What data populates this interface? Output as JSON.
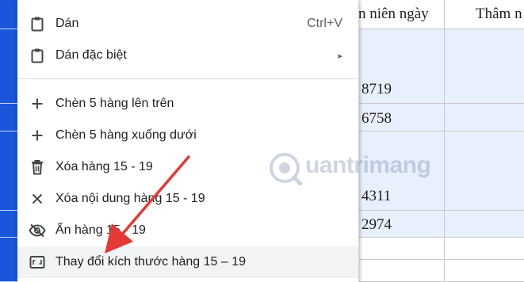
{
  "sheet": {
    "headers": [
      "n niên ngày",
      "Thâm n"
    ],
    "values": [
      "8719",
      "6758",
      "4311",
      "2974"
    ]
  },
  "menu": {
    "items": [
      {
        "label": "Dán",
        "shortcut": "Ctrl+V",
        "icon": "clipboard-icon"
      },
      {
        "label": "Dán đặc biệt",
        "icon": "clipboard-icon",
        "submenu": "▸"
      },
      {
        "label": "Chèn 5 hàng lên trên",
        "icon": "plus-icon"
      },
      {
        "label": "Chèn 5 hàng xuống dưới",
        "icon": "plus-icon"
      },
      {
        "label": "Xóa hàng 15 - 19",
        "icon": "trash-icon"
      },
      {
        "label": "Xóa nội dung hàng 15 - 19",
        "icon": "close-icon"
      },
      {
        "label": "Ẩn hàng 15 - 19",
        "icon": "eye-off-icon"
      },
      {
        "label": "Thay đổi kích thước hàng 15 – 19",
        "icon": "resize-icon"
      }
    ]
  },
  "watermark": {
    "text": "uantrimang"
  },
  "colors": {
    "accent": "#1a56db",
    "selection": "#e8f0fe",
    "arrow": "#e53935",
    "menu_highlight": "#f1f3f4"
  }
}
